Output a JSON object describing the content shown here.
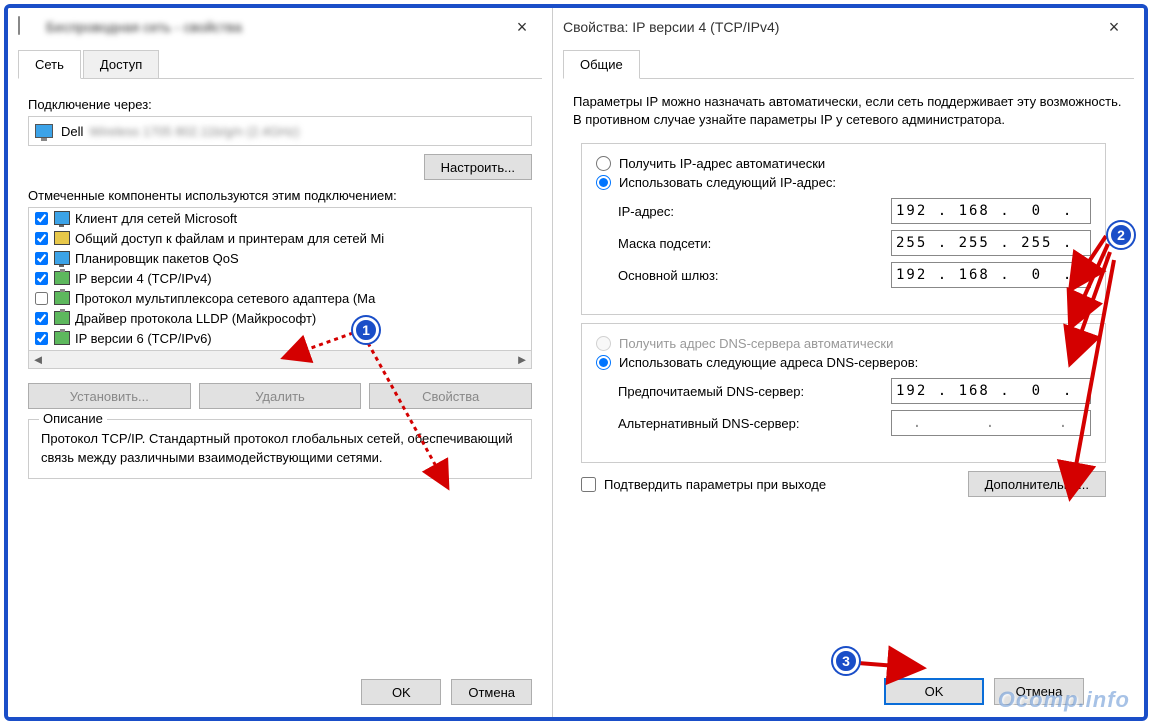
{
  "left": {
    "title": "Беспроводная сеть - свойства",
    "tabs": {
      "network": "Сеть",
      "access": "Доступ"
    },
    "connect_via": "Подключение через:",
    "device": "Dell",
    "device_blurred": "Wireless 1705 802.11b/g/n (2.4GHz)",
    "configure": "Настроить...",
    "components_label": "Отмеченные компоненты используются этим подключением:",
    "components": [
      {
        "checked": true,
        "icon": "green",
        "label": "Клиент для сетей Microsoft"
      },
      {
        "checked": true,
        "icon": "yellow",
        "label": "Общий доступ к файлам и принтерам для сетей Mi"
      },
      {
        "checked": true,
        "icon": "green",
        "label": "Планировщик пакетов QoS"
      },
      {
        "checked": true,
        "icon": "adapter",
        "label": "IP версии 4 (TCP/IPv4)"
      },
      {
        "checked": false,
        "icon": "adapter",
        "label": "Протокол мультиплексора сетевого адаптера (Ма"
      },
      {
        "checked": true,
        "icon": "adapter",
        "label": "Драйвер протокола LLDP (Майкрософт)"
      },
      {
        "checked": true,
        "icon": "adapter",
        "label": "IP версии 6 (TCP/IPv6)"
      }
    ],
    "install": "Установить...",
    "remove": "Удалить",
    "properties": "Свойства",
    "desc_legend": "Описание",
    "desc_text": "Протокол TCP/IP. Стандартный протокол глобальных сетей, обеспечивающий связь между различными взаимодействующими сетями.",
    "ok": "OK",
    "cancel": "Отмена"
  },
  "right": {
    "title": "Свойства: IP версии 4 (TCP/IPv4)",
    "tab_general": "Общие",
    "info": "Параметры IP можно назначать автоматически, если сеть поддерживает эту возможность. В противном случае узнайте параметры IP у сетевого администратора.",
    "auto_ip": "Получить IP-адрес автоматически",
    "manual_ip": "Использовать следующий IP-адрес:",
    "ip_label": "IP-адрес:",
    "mask_label": "Маска подсети:",
    "gateway_label": "Основной шлюз:",
    "ip_value": "192 . 168 .  0  .  2",
    "mask_value": "255 . 255 . 255 .  0",
    "gateway_value": "192 . 168 .  0  .  1",
    "auto_dns": "Получить адрес DNS-сервера автоматически",
    "manual_dns": "Использовать следующие адреса DNS-серверов:",
    "dns1_label": "Предпочитаемый DNS-сервер:",
    "dns2_label": "Альтернативный DNS-сервер:",
    "dns1_value": "192 . 168 .  0  .  1",
    "dns2_value": ".      .      .",
    "validate": "Подтвердить параметры при выходе",
    "advanced": "Дополнительно...",
    "ok": "OK",
    "cancel": "Отмена"
  },
  "badges": {
    "b1": "1",
    "b2": "2",
    "b3": "3"
  },
  "watermark": "Ocomp.info"
}
